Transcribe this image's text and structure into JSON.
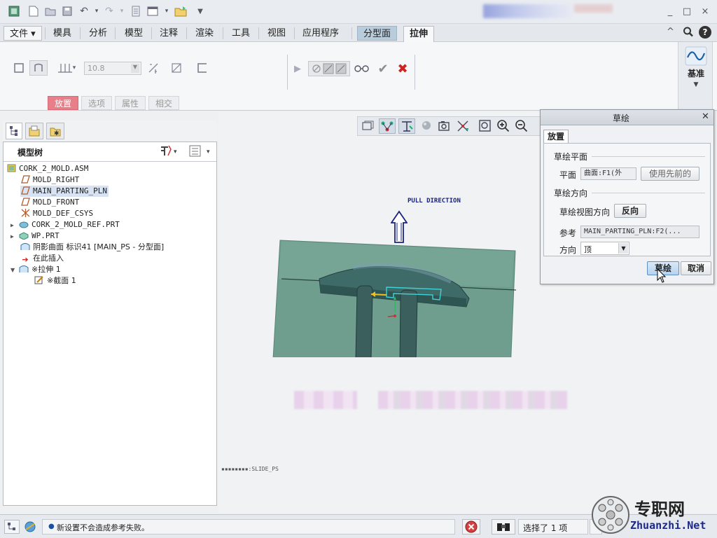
{
  "titlebar": {
    "quick_access": [
      "app-icon",
      "new-icon",
      "open-icon",
      "save-icon",
      "undo-icon",
      "redo-icon",
      "regenerate-icon",
      "windows-icon",
      "folder-icon",
      "more-icon"
    ],
    "window_controls": [
      "_",
      "□",
      "×"
    ]
  },
  "menu": {
    "file": "文件",
    "tabs": [
      "模具",
      "分析",
      "模型",
      "注释",
      "渲染",
      "工具",
      "视图",
      "应用程序",
      "分型面",
      "拉伸"
    ],
    "active_split": "分型面",
    "active_extrude": "拉伸"
  },
  "ribbon": {
    "depth_value": "10.8",
    "subtabs": [
      "放置",
      "选项",
      "属性",
      "相交"
    ],
    "datum_label": "基准"
  },
  "model_tree": {
    "title": "模型树",
    "items": [
      {
        "label": "CORK_2_MOLD.ASM",
        "icon": "assembly-icon",
        "indent": 0,
        "expand": ""
      },
      {
        "label": "MOLD_RIGHT",
        "icon": "datum-plane-icon",
        "indent": 1,
        "expand": ""
      },
      {
        "label": "MAIN_PARTING_PLN",
        "icon": "datum-plane-icon",
        "indent": 1,
        "expand": "",
        "selected": true
      },
      {
        "label": "MOLD_FRONT",
        "icon": "datum-plane-icon",
        "indent": 1,
        "expand": ""
      },
      {
        "label": "MOLD_DEF_CSYS",
        "icon": "csys-icon",
        "indent": 1,
        "expand": ""
      },
      {
        "label": "CORK_2_MOLD_REF.PRT",
        "icon": "part-icon",
        "indent": 1,
        "expand": "▶"
      },
      {
        "label": "WP.PRT",
        "icon": "workpiece-icon",
        "indent": 1,
        "expand": "▶"
      },
      {
        "label": "阴影曲面 标识41 [MAIN_PS - 分型面]",
        "icon": "surface-icon",
        "indent": 1,
        "expand": ""
      },
      {
        "label": "在此插入",
        "icon": "insert-arrow-icon",
        "indent": 1,
        "expand": ""
      },
      {
        "label": "※拉伸 1",
        "icon": "extrude-icon",
        "indent": 1,
        "expand": "▼"
      },
      {
        "label": "※截面 1",
        "icon": "sketch-icon",
        "indent": 2,
        "expand": ""
      }
    ]
  },
  "viewport": {
    "pull_direction": "PULL DIRECTION",
    "slide_label": "SLIDE_PS"
  },
  "dialog": {
    "title": "草绘",
    "tab": "放置",
    "sketch_plane_group": "草绘平面",
    "plane_label": "平面",
    "plane_value": "曲面:F1(外",
    "use_previous": "使用先前的",
    "orientation_group": "草绘方向",
    "view_direction_label": "草绘视图方向",
    "flip": "反向",
    "reference_label": "参考",
    "reference_value": "MAIN_PARTING_PLN:F2(...",
    "direction_label": "方向",
    "direction_value": "顶",
    "ok": "草绘",
    "cancel": "取消"
  },
  "statusbar": {
    "message": "新设置不会造成参考失败。",
    "selection": "选择了 1 项",
    "watermark_cn": "专职网",
    "watermark_url": "Zhuanzhi.Net"
  },
  "colors": {
    "mold_fill": "#6f9e8f",
    "selected_row": "#d7e3f2",
    "accent_red": "#cc2222"
  }
}
